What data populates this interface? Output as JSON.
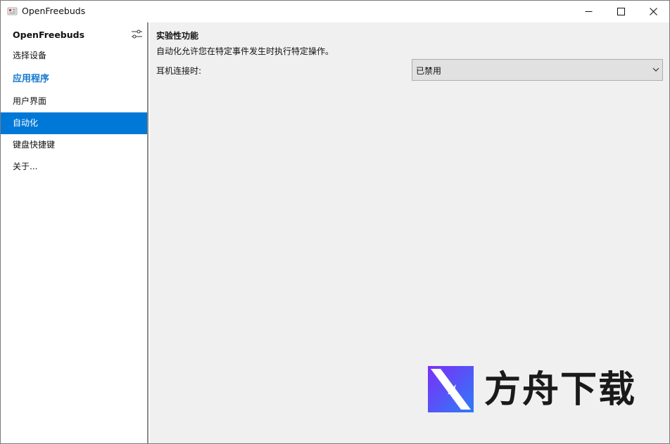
{
  "window": {
    "title": "OpenFreebuds"
  },
  "sidebar": {
    "title": "OpenFreebuds",
    "items": [
      {
        "label": "选择设备",
        "kind": "normal"
      },
      {
        "label": "应用程序",
        "kind": "section"
      },
      {
        "label": "用户界面",
        "kind": "normal"
      },
      {
        "label": "自动化",
        "kind": "active"
      },
      {
        "label": "键盘快捷键",
        "kind": "normal"
      },
      {
        "label": "关于...",
        "kind": "normal"
      }
    ]
  },
  "main": {
    "section_title": "实验性功能",
    "description": "自动化允许您在特定事件发生时执行特定操作。",
    "field_label": "耳机连接时:",
    "select_value": "已禁用"
  },
  "watermark": {
    "text": "方舟下载"
  },
  "colors": {
    "accent": "#0078d7",
    "section_text": "#1679cf",
    "content_bg": "#f0f0f0"
  }
}
